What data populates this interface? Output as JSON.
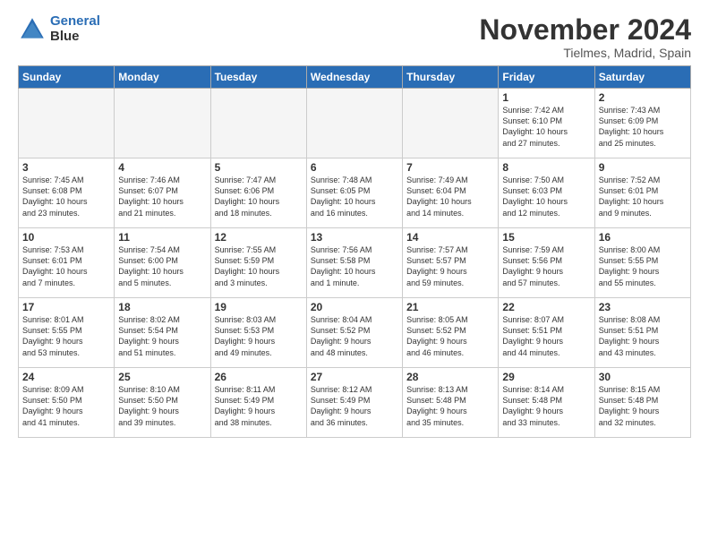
{
  "logo": {
    "line1": "General",
    "line2": "Blue"
  },
  "title": "November 2024",
  "location": "Tielmes, Madrid, Spain",
  "days_header": [
    "Sunday",
    "Monday",
    "Tuesday",
    "Wednesday",
    "Thursday",
    "Friday",
    "Saturday"
  ],
  "weeks": [
    [
      {
        "num": "",
        "info": "",
        "empty": true
      },
      {
        "num": "",
        "info": "",
        "empty": true
      },
      {
        "num": "",
        "info": "",
        "empty": true
      },
      {
        "num": "",
        "info": "",
        "empty": true
      },
      {
        "num": "",
        "info": "",
        "empty": true
      },
      {
        "num": "1",
        "info": "Sunrise: 7:42 AM\nSunset: 6:10 PM\nDaylight: 10 hours\nand 27 minutes.",
        "empty": false
      },
      {
        "num": "2",
        "info": "Sunrise: 7:43 AM\nSunset: 6:09 PM\nDaylight: 10 hours\nand 25 minutes.",
        "empty": false
      }
    ],
    [
      {
        "num": "3",
        "info": "Sunrise: 7:45 AM\nSunset: 6:08 PM\nDaylight: 10 hours\nand 23 minutes.",
        "empty": false
      },
      {
        "num": "4",
        "info": "Sunrise: 7:46 AM\nSunset: 6:07 PM\nDaylight: 10 hours\nand 21 minutes.",
        "empty": false
      },
      {
        "num": "5",
        "info": "Sunrise: 7:47 AM\nSunset: 6:06 PM\nDaylight: 10 hours\nand 18 minutes.",
        "empty": false
      },
      {
        "num": "6",
        "info": "Sunrise: 7:48 AM\nSunset: 6:05 PM\nDaylight: 10 hours\nand 16 minutes.",
        "empty": false
      },
      {
        "num": "7",
        "info": "Sunrise: 7:49 AM\nSunset: 6:04 PM\nDaylight: 10 hours\nand 14 minutes.",
        "empty": false
      },
      {
        "num": "8",
        "info": "Sunrise: 7:50 AM\nSunset: 6:03 PM\nDaylight: 10 hours\nand 12 minutes.",
        "empty": false
      },
      {
        "num": "9",
        "info": "Sunrise: 7:52 AM\nSunset: 6:01 PM\nDaylight: 10 hours\nand 9 minutes.",
        "empty": false
      }
    ],
    [
      {
        "num": "10",
        "info": "Sunrise: 7:53 AM\nSunset: 6:01 PM\nDaylight: 10 hours\nand 7 minutes.",
        "empty": false
      },
      {
        "num": "11",
        "info": "Sunrise: 7:54 AM\nSunset: 6:00 PM\nDaylight: 10 hours\nand 5 minutes.",
        "empty": false
      },
      {
        "num": "12",
        "info": "Sunrise: 7:55 AM\nSunset: 5:59 PM\nDaylight: 10 hours\nand 3 minutes.",
        "empty": false
      },
      {
        "num": "13",
        "info": "Sunrise: 7:56 AM\nSunset: 5:58 PM\nDaylight: 10 hours\nand 1 minute.",
        "empty": false
      },
      {
        "num": "14",
        "info": "Sunrise: 7:57 AM\nSunset: 5:57 PM\nDaylight: 9 hours\nand 59 minutes.",
        "empty": false
      },
      {
        "num": "15",
        "info": "Sunrise: 7:59 AM\nSunset: 5:56 PM\nDaylight: 9 hours\nand 57 minutes.",
        "empty": false
      },
      {
        "num": "16",
        "info": "Sunrise: 8:00 AM\nSunset: 5:55 PM\nDaylight: 9 hours\nand 55 minutes.",
        "empty": false
      }
    ],
    [
      {
        "num": "17",
        "info": "Sunrise: 8:01 AM\nSunset: 5:55 PM\nDaylight: 9 hours\nand 53 minutes.",
        "empty": false
      },
      {
        "num": "18",
        "info": "Sunrise: 8:02 AM\nSunset: 5:54 PM\nDaylight: 9 hours\nand 51 minutes.",
        "empty": false
      },
      {
        "num": "19",
        "info": "Sunrise: 8:03 AM\nSunset: 5:53 PM\nDaylight: 9 hours\nand 49 minutes.",
        "empty": false
      },
      {
        "num": "20",
        "info": "Sunrise: 8:04 AM\nSunset: 5:52 PM\nDaylight: 9 hours\nand 48 minutes.",
        "empty": false
      },
      {
        "num": "21",
        "info": "Sunrise: 8:05 AM\nSunset: 5:52 PM\nDaylight: 9 hours\nand 46 minutes.",
        "empty": false
      },
      {
        "num": "22",
        "info": "Sunrise: 8:07 AM\nSunset: 5:51 PM\nDaylight: 9 hours\nand 44 minutes.",
        "empty": false
      },
      {
        "num": "23",
        "info": "Sunrise: 8:08 AM\nSunset: 5:51 PM\nDaylight: 9 hours\nand 43 minutes.",
        "empty": false
      }
    ],
    [
      {
        "num": "24",
        "info": "Sunrise: 8:09 AM\nSunset: 5:50 PM\nDaylight: 9 hours\nand 41 minutes.",
        "empty": false
      },
      {
        "num": "25",
        "info": "Sunrise: 8:10 AM\nSunset: 5:50 PM\nDaylight: 9 hours\nand 39 minutes.",
        "empty": false
      },
      {
        "num": "26",
        "info": "Sunrise: 8:11 AM\nSunset: 5:49 PM\nDaylight: 9 hours\nand 38 minutes.",
        "empty": false
      },
      {
        "num": "27",
        "info": "Sunrise: 8:12 AM\nSunset: 5:49 PM\nDaylight: 9 hours\nand 36 minutes.",
        "empty": false
      },
      {
        "num": "28",
        "info": "Sunrise: 8:13 AM\nSunset: 5:48 PM\nDaylight: 9 hours\nand 35 minutes.",
        "empty": false
      },
      {
        "num": "29",
        "info": "Sunrise: 8:14 AM\nSunset: 5:48 PM\nDaylight: 9 hours\nand 33 minutes.",
        "empty": false
      },
      {
        "num": "30",
        "info": "Sunrise: 8:15 AM\nSunset: 5:48 PM\nDaylight: 9 hours\nand 32 minutes.",
        "empty": false
      }
    ]
  ]
}
